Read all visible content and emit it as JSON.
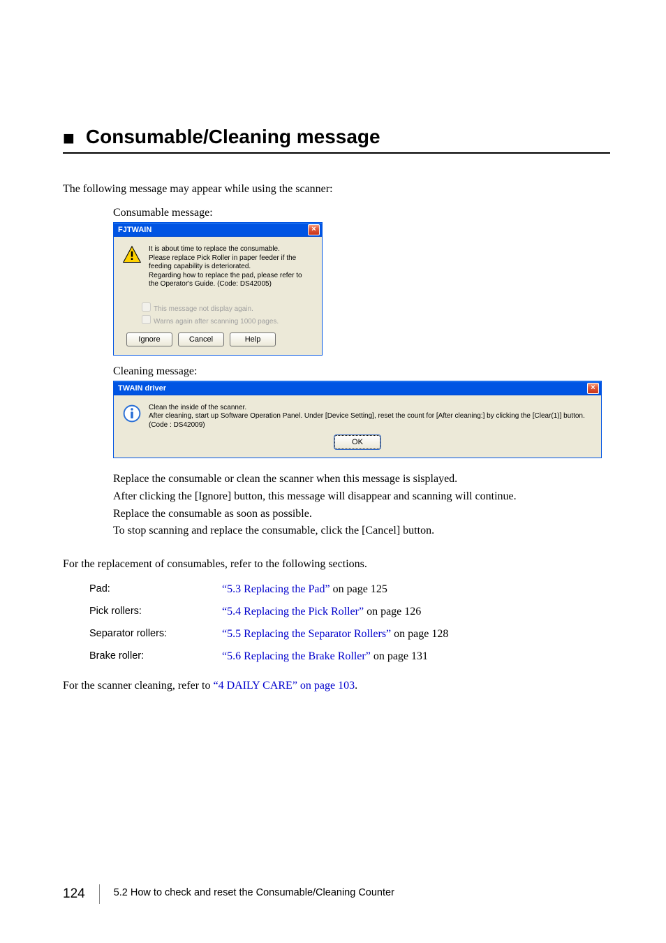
{
  "heading": "Consumable/Cleaning message",
  "intro": "The following message may appear while using the scanner:",
  "consumable_caption": "Consumable message:",
  "cleaning_caption": "Cleaning message:",
  "dialog1": {
    "title": "FJTWAIN",
    "message": "It is about time to replace the consumable.\nPlease replace Pick Roller in paper feeder if the feeding capability is deteriorated.\nRegarding how to replace the pad, please refer to the Operator's Guide. (Code: DS42005)",
    "check1": "This message not display again.",
    "check2": "Warns again after scanning 1000 pages.",
    "btn_ignore": "Ignore",
    "btn_cancel": "Cancel",
    "btn_help": "Help"
  },
  "dialog2": {
    "title": "TWAIN driver",
    "message": "Clean the inside of the scanner.\nAfter cleaning, start up Software Operation Panel. Under [Device Setting], reset the count for [After cleaning:] by clicking the [Clear(1)] button.\n(Code : DS42009)",
    "btn_ok": "OK"
  },
  "explain": {
    "l1": "Replace the consumable or clean the scanner when this message is sisplayed.",
    "l2": "After clicking the [Ignore] button, this message will disappear and scanning will continue.",
    "l3": "Replace the consumable as soon as possible.",
    "l4": "To stop scanning and replace the consumable, click the [Cancel] button."
  },
  "ref_intro": "For the replacement of consumables, refer to the following sections.",
  "refs": {
    "pad": {
      "label": "Pad:",
      "link": "“5.3 Replacing the Pad”",
      "tail": " on page 125"
    },
    "pick": {
      "label": "Pick rollers:",
      "link": "“5.4 Replacing the Pick Roller”",
      "tail": " on page 126"
    },
    "sep": {
      "label": "Separator rollers:",
      "link": "“5.5 Replacing the Separator Rollers”",
      "tail": " on page 128"
    },
    "brake": {
      "label": "Brake roller:",
      "link": "“5.6 Replacing the Brake Roller”",
      "tail": " on page 131"
    }
  },
  "clean_ref_pre": "For the scanner cleaning, refer to ",
  "clean_ref_link": "“4 DAILY CARE” on page 103",
  "clean_ref_post": ".",
  "footer": {
    "page": "124",
    "caption": "5.2 How to check and reset the Consumable/Cleaning Counter"
  }
}
